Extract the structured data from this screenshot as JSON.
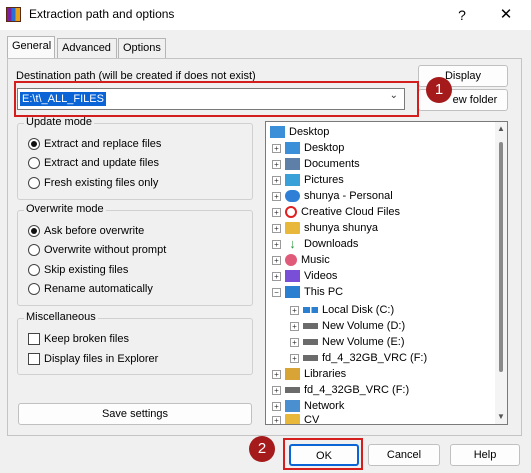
{
  "window": {
    "title": "Extraction path and options",
    "help_glyph": "?",
    "close_glyph": "✕"
  },
  "tabs": [
    {
      "label": "General",
      "active": true
    },
    {
      "label": "Advanced",
      "active": false
    },
    {
      "label": "Options",
      "active": false
    }
  ],
  "destination": {
    "label": "Destination path (will be created if does not exist)",
    "value": "E:\\t\\_ALL_FILES",
    "display_button": "Display",
    "new_folder_button": "New folder",
    "new_folder_visible_text": "ew folder"
  },
  "update_mode": {
    "title": "Update mode",
    "options": [
      {
        "label": "Extract and replace files",
        "checked": true
      },
      {
        "label": "Extract and update files",
        "checked": false
      },
      {
        "label": "Fresh existing files only",
        "checked": false
      }
    ]
  },
  "overwrite_mode": {
    "title": "Overwrite mode",
    "options": [
      {
        "label": "Ask before overwrite",
        "checked": true
      },
      {
        "label": "Overwrite without prompt",
        "checked": false
      },
      {
        "label": "Skip existing files",
        "checked": false
      },
      {
        "label": "Rename automatically",
        "checked": false
      }
    ]
  },
  "miscellaneous": {
    "title": "Miscellaneous",
    "options": [
      {
        "label": "Keep broken files",
        "checked": false
      },
      {
        "label": "Display files in Explorer",
        "checked": false
      }
    ]
  },
  "save_settings_button": "Save settings",
  "tree": {
    "items": [
      {
        "label": "Desktop",
        "icon": "desktop-folder-icon"
      },
      {
        "label": "Desktop",
        "icon": "desktop-folder-icon"
      },
      {
        "label": "Documents",
        "icon": "documents-icon"
      },
      {
        "label": "Pictures",
        "icon": "pictures-icon"
      },
      {
        "label": "shunya - Personal",
        "icon": "onedrive-cloud-icon"
      },
      {
        "label": "Creative Cloud Files",
        "icon": "creative-cloud-icon"
      },
      {
        "label": "shunya shunya",
        "icon": "folder-icon"
      },
      {
        "label": "Downloads",
        "icon": "downloads-icon"
      },
      {
        "label": "Music",
        "icon": "music-icon"
      },
      {
        "label": "Videos",
        "icon": "videos-icon"
      },
      {
        "label": "This PC",
        "icon": "this-pc-icon"
      },
      {
        "label": "Local Disk (C:)",
        "icon": "windows-drive-icon"
      },
      {
        "label": "New Volume (D:)",
        "icon": "drive-icon"
      },
      {
        "label": "New Volume (E:)",
        "icon": "drive-icon"
      },
      {
        "label": "fd_4_32GB_VRC (F:)",
        "icon": "usb-drive-icon"
      },
      {
        "label": "Libraries",
        "icon": "libraries-icon"
      },
      {
        "label": "fd_4_32GB_VRC (F:)",
        "icon": "usb-drive-icon"
      },
      {
        "label": "Network",
        "icon": "network-icon"
      },
      {
        "label": "CV",
        "icon": "folder-icon"
      }
    ],
    "expander_plus": "+",
    "expander_minus": "−"
  },
  "footer": {
    "ok": "OK",
    "cancel": "Cancel",
    "help": "Help"
  },
  "annotations": {
    "step1": "1",
    "step2": "2",
    "highlight_color": "#d41e1e",
    "badge_color": "#a51a1a"
  },
  "colors": {
    "selection": "#0a64d6",
    "dialog_bg": "#f0f0f0"
  }
}
